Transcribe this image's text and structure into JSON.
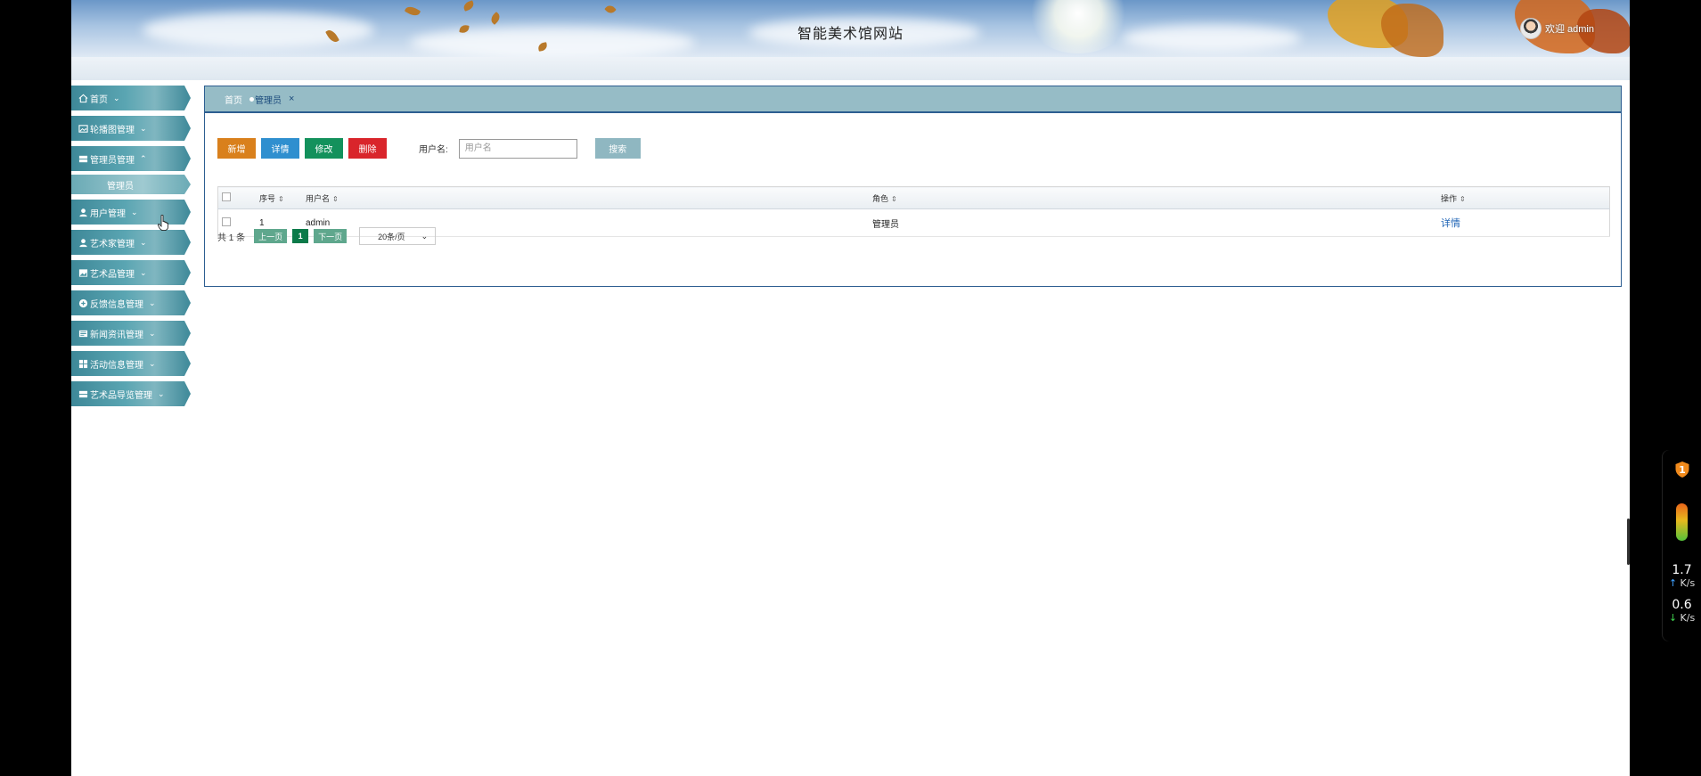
{
  "header": {
    "site_title": "智能美术馆网站",
    "welcome": "欢迎 admin"
  },
  "sidebar": {
    "items": [
      {
        "label": "首页",
        "icon": "home-icon",
        "chevron": "⌄"
      },
      {
        "label": "轮播图管理",
        "icon": "image-icon",
        "chevron": "⌄"
      },
      {
        "label": "管理员管理",
        "icon": "list-icon",
        "chevron": "⌃"
      },
      {
        "label": "用户管理",
        "icon": "user-icon",
        "chevron": "⌄"
      },
      {
        "label": "艺术家管理",
        "icon": "user-icon",
        "chevron": "⌄"
      },
      {
        "label": "艺术品管理",
        "icon": "picture-icon",
        "chevron": "⌄"
      },
      {
        "label": "反馈信息管理",
        "icon": "plus-circle-icon",
        "chevron": "⌄"
      },
      {
        "label": "新闻资讯管理",
        "icon": "news-icon",
        "chevron": "⌄"
      },
      {
        "label": "活动信息管理",
        "icon": "grid-icon",
        "chevron": "⌄"
      },
      {
        "label": "艺术品导览管理",
        "icon": "list-icon",
        "chevron": "⌄"
      }
    ],
    "subitems": {
      "admin": "管理员"
    }
  },
  "tabs": {
    "home": "首页",
    "active": "管理员",
    "close": "×"
  },
  "toolbar": {
    "add": "新增",
    "detail": "详情",
    "edit": "修改",
    "delete": "删除",
    "search_label": "用户名:",
    "search_placeholder": "用户名",
    "search_button": "搜索"
  },
  "table": {
    "headers": [
      "序号",
      "用户名",
      "角色",
      "操作"
    ],
    "sort_icon": "⇕",
    "rows": [
      {
        "index": "1",
        "username": "admin",
        "role": "管理员",
        "action": "详情"
      }
    ]
  },
  "pager": {
    "total": "共 1 条",
    "prev": "上一页",
    "current": "1",
    "next": "下一页",
    "page_size": "20条/页"
  },
  "widget": {
    "badge": "1",
    "upload_value": "1.7",
    "upload_unit": "K/s",
    "download_value": "0.6",
    "download_unit": "K/s",
    "up_arrow": "↑",
    "down_arrow": "↓"
  },
  "colors": {
    "nav_teal": "#3e8898",
    "tabbar": "#96bcc6",
    "add": "#d9801c",
    "detail": "#2f8fcf",
    "edit": "#13915c",
    "delete": "#d9252b",
    "pager_green": "#0b7a49"
  }
}
